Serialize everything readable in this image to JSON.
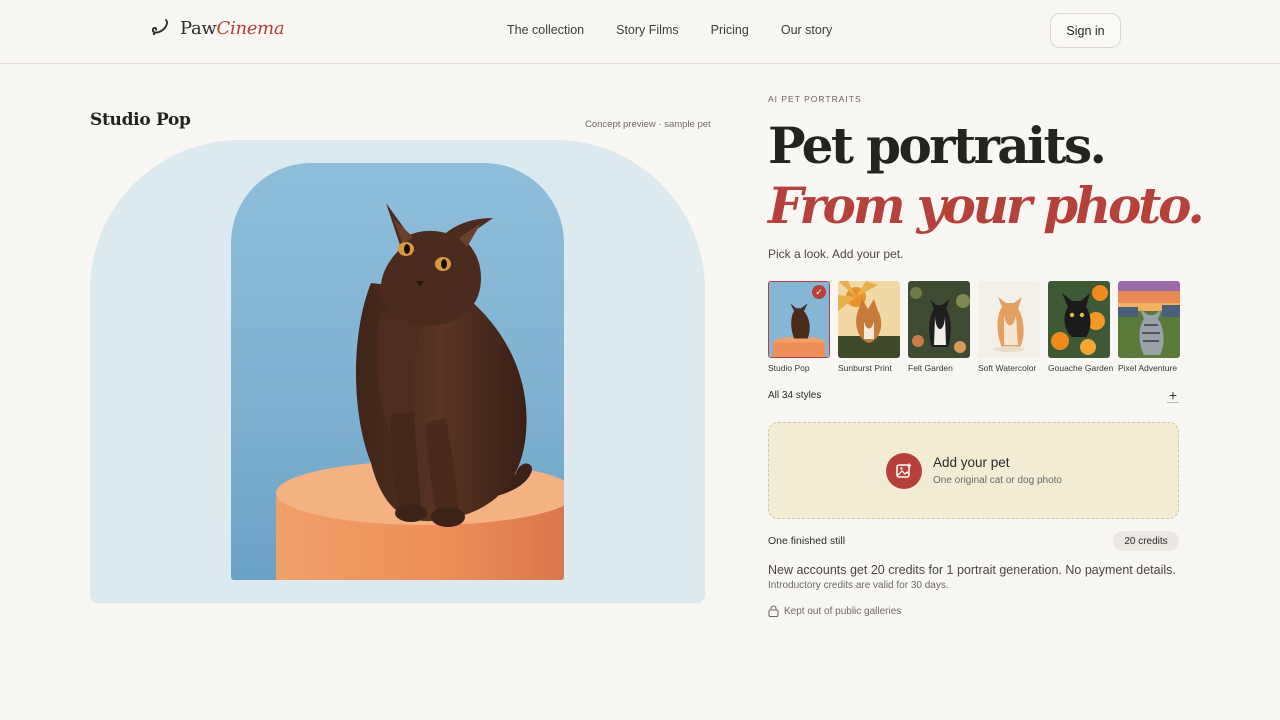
{
  "brand": {
    "name_plain": "Paw",
    "name_accent": "Cinema",
    "icon": "brand-swirl-icon",
    "accent_color": "#b5413a"
  },
  "nav": {
    "links": [
      "The collection",
      "Story Films",
      "Pricing",
      "Our story"
    ],
    "signin_label": "Sign in"
  },
  "preview": {
    "style_name": "Studio Pop",
    "note": "Concept preview · sample pet"
  },
  "hero": {
    "eyebrow": "AI PET PORTRAITS",
    "headline_line1": "Pet portraits.",
    "headline_line2": "From your photo.",
    "subtitle": "Pick a look. Add your pet."
  },
  "styles": {
    "items": [
      {
        "label": "Studio Pop",
        "selected": true
      },
      {
        "label": "Sunburst Print",
        "selected": false
      },
      {
        "label": "Felt Garden",
        "selected": false
      },
      {
        "label": "Soft Watercolor",
        "selected": false
      },
      {
        "label": "Gouache Garden",
        "selected": false
      },
      {
        "label": "Pixel Adventure",
        "selected": false
      }
    ],
    "all_label": "All 34 styles",
    "expand_icon": "plus-icon"
  },
  "upload": {
    "title": "Add your pet",
    "subtitle": "One original cat or dog photo",
    "icon": "add-photo-icon"
  },
  "pricing": {
    "deliverable": "One finished still",
    "credits": "20 credits",
    "offer": "New accounts get 20 credits for 1 portrait generation. No payment details.",
    "note": "Introductory credits are valid for 30 days."
  },
  "privacy": {
    "text": "Kept out of public galleries",
    "icon": "lock-icon"
  }
}
